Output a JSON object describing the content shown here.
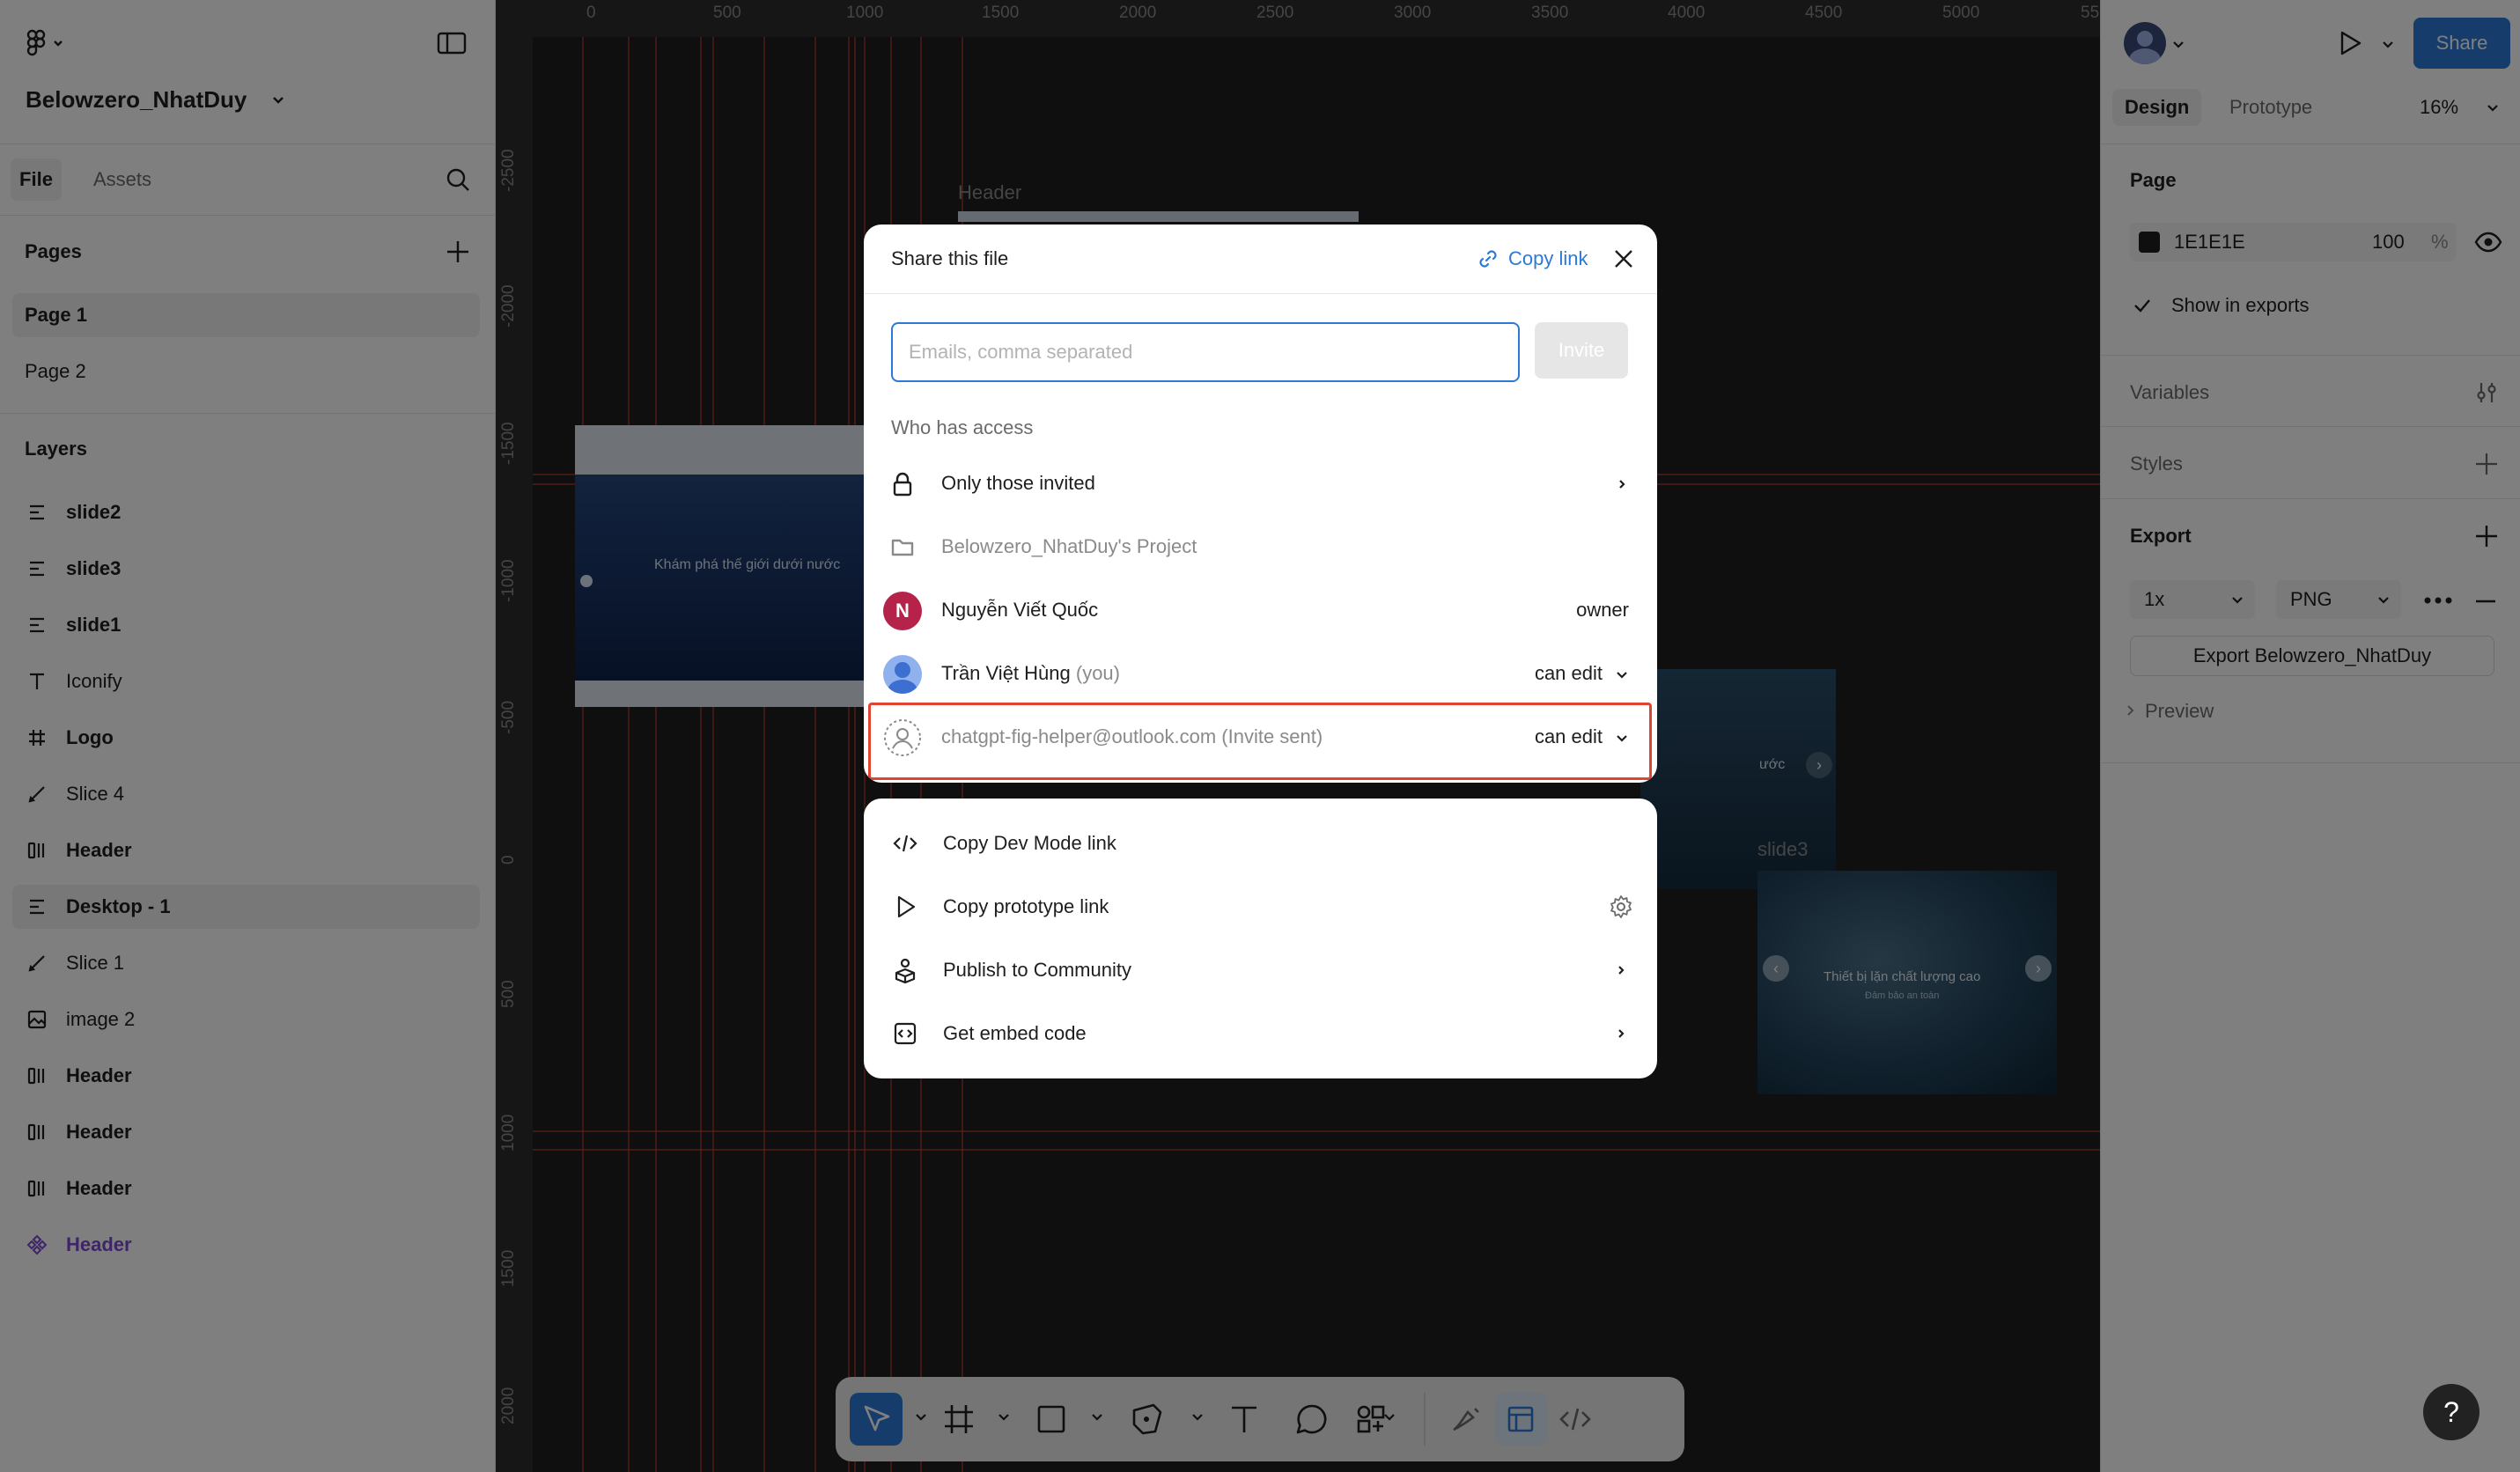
{
  "app": {
    "file_name": "Belowzero_NhatDuy"
  },
  "left_panel": {
    "tabs": {
      "file": "File",
      "assets": "Assets"
    },
    "pages_title": "Pages",
    "pages": [
      "Page 1",
      "Page 2"
    ],
    "layers_title": "Layers",
    "layers": [
      {
        "label": "slide2",
        "icon": "auto-layout-icon"
      },
      {
        "label": "slide3",
        "icon": "auto-layout-icon"
      },
      {
        "label": "slide1",
        "icon": "auto-layout-icon"
      },
      {
        "label": "Iconify",
        "icon": "text-icon"
      },
      {
        "label": "Logo",
        "icon": "frame-icon"
      },
      {
        "label": "Slice 4",
        "icon": "slice-icon"
      },
      {
        "label": "Header",
        "icon": "horizontal-layout-icon"
      },
      {
        "label": "Desktop - 1",
        "icon": "auto-layout-icon"
      },
      {
        "label": "Slice 1",
        "icon": "slice-icon"
      },
      {
        "label": "image 2",
        "icon": "image-icon"
      },
      {
        "label": "Header",
        "icon": "horizontal-layout-icon"
      },
      {
        "label": "Header",
        "icon": "horizontal-layout-icon"
      },
      {
        "label": "Header",
        "icon": "horizontal-layout-icon"
      },
      {
        "label": "Header",
        "icon": "component-icon"
      }
    ]
  },
  "canvas": {
    "ruler_top": [
      "0",
      "500",
      "1000",
      "1500",
      "2000",
      "2500",
      "3000",
      "3500",
      "4000",
      "4500",
      "5000",
      "55"
    ],
    "ruler_left": [
      "-2500",
      "-2000",
      "-1500",
      "-1000",
      "-500",
      "0",
      "500",
      "1000",
      "1500",
      "2000"
    ],
    "frame_labels": {
      "header": "Header",
      "slide3": "slide3"
    },
    "thumb_texts": {
      "slide1_heading": "Khám phá thế giới dưới nước",
      "slide3_heading": "Thiết bị lặn chất lượng cao",
      "slide3_sub": "Đảm bảo an toàn",
      "slide2_heading": "ước"
    }
  },
  "right_panel": {
    "share_label": "Share",
    "tabs": {
      "design": "Design",
      "prototype": "Prototype"
    },
    "zoom": "16%",
    "page_title": "Page",
    "page_color": "1E1E1E",
    "page_opacity": "100",
    "percent_sign": "%",
    "show_in_exports": "Show in exports",
    "variables_title": "Variables",
    "styles_title": "Styles",
    "export_title": "Export",
    "export_scale": "1x",
    "export_format": "PNG",
    "export_button": "Export Belowzero_NhatDuy",
    "preview_label": "Preview",
    "colors": {
      "accent": "#2d79d6",
      "page_fill": "#1E1E1E"
    }
  },
  "share_modal": {
    "title": "Share this file",
    "copy_link": "Copy link",
    "email_placeholder": "Emails, comma separated",
    "invite_label": "Invite",
    "access_heading": "Who has access",
    "access_rows": [
      {
        "name": "Only those invited",
        "icon": "lock-icon"
      },
      {
        "name": "Belowzero_NhatDuy's Project",
        "icon": "folder-icon"
      },
      {
        "name": "Nguyễn Viết Quốc",
        "initial": "N",
        "role": "owner"
      },
      {
        "name": "Trần Việt Hùng",
        "you": "(you)",
        "role": "can edit"
      },
      {
        "name": "chatgpt-fig-helper@outlook.com (Invite sent)",
        "role": "can edit"
      }
    ],
    "actions": [
      {
        "label": "Copy Dev Mode link",
        "icon": "code-icon"
      },
      {
        "label": "Copy prototype link",
        "icon": "play-icon"
      },
      {
        "label": "Publish to Community",
        "icon": "community-icon"
      },
      {
        "label": "Get embed code",
        "icon": "embed-icon"
      }
    ],
    "colors": {
      "link": "#2d79d6",
      "highlight": "#e2452f",
      "owner_avatar": "#b5234a"
    }
  },
  "help": "?"
}
